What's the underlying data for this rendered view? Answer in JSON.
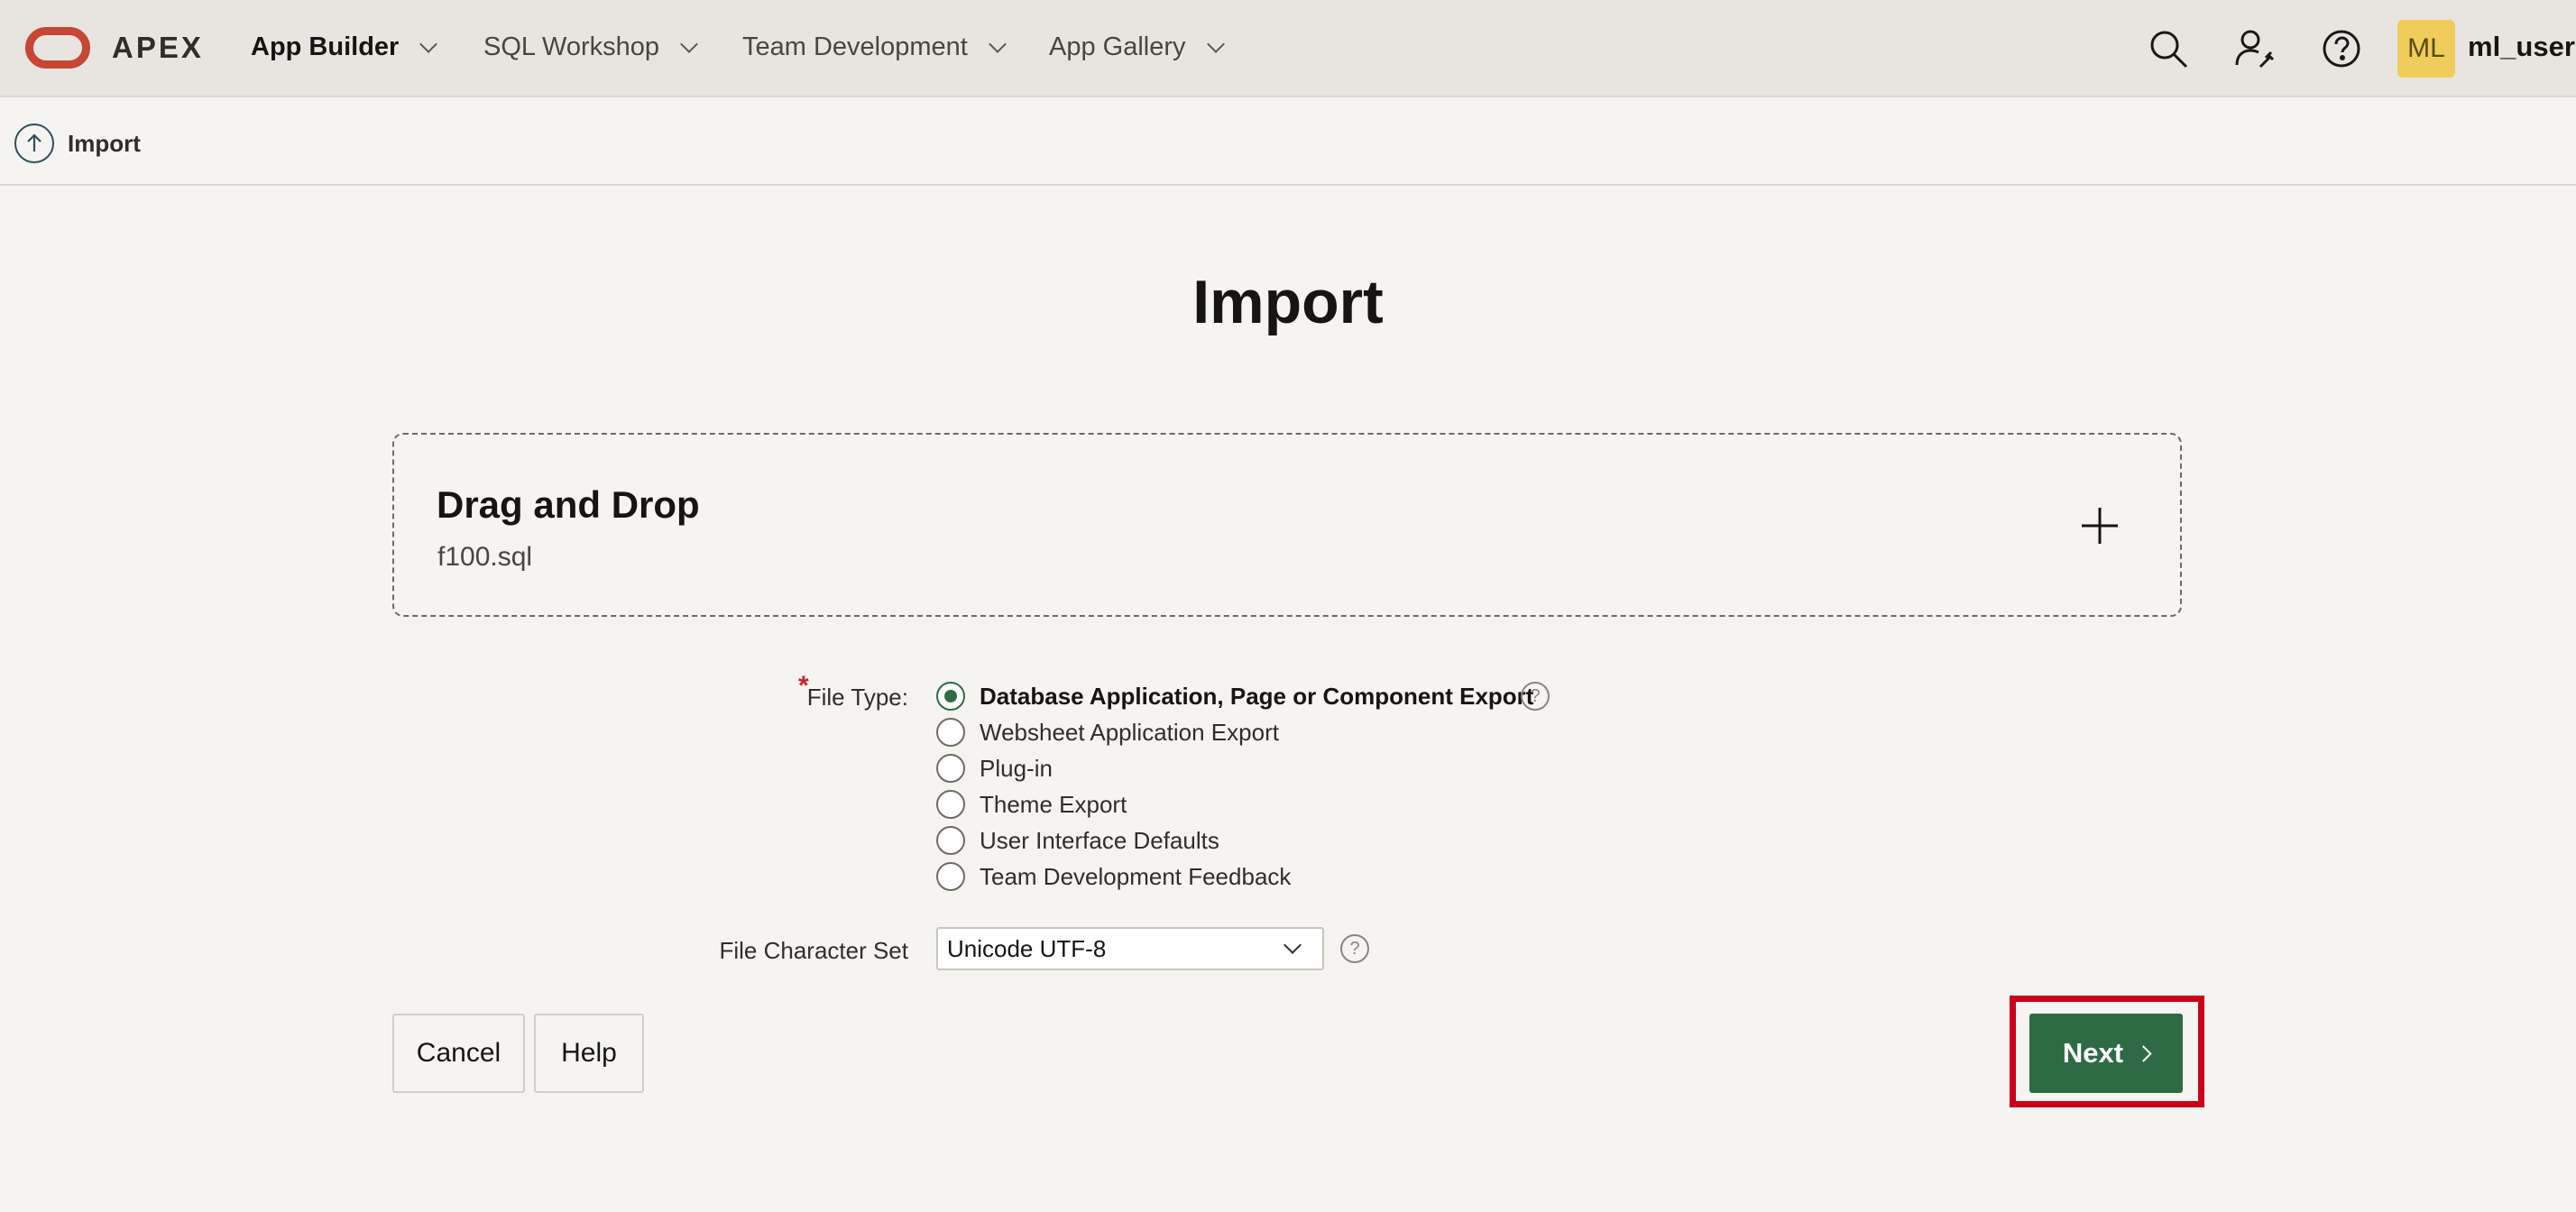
{
  "header": {
    "app_name": "APEX",
    "nav": [
      {
        "label": "App Builder",
        "active": true
      },
      {
        "label": "SQL Workshop",
        "active": false
      },
      {
        "label": "Team Development",
        "active": false
      },
      {
        "label": "App Gallery",
        "active": false
      }
    ],
    "icons": [
      "search-icon",
      "admin-user-icon",
      "help-icon"
    ],
    "user": {
      "initials": "ML",
      "name": "ml_user"
    }
  },
  "breadcrumb": {
    "icon": "upload-arrow-icon",
    "label": "Import"
  },
  "main": {
    "title": "Import",
    "dropzone": {
      "title": "Drag and Drop",
      "file_name": "f100.sql",
      "icon": "plus-icon"
    },
    "file_type": {
      "label": "File Type:",
      "required_mark": "*",
      "options": [
        {
          "label": "Database Application, Page or Component Export",
          "checked": true
        },
        {
          "label": "Websheet Application Export",
          "checked": false
        },
        {
          "label": "Plug-in",
          "checked": false
        },
        {
          "label": "Theme Export",
          "checked": false
        },
        {
          "label": "User Interface Defaults",
          "checked": false
        },
        {
          "label": "Team Development Feedback",
          "checked": false
        }
      ],
      "help_glyph": "?"
    },
    "charset": {
      "label": "File Character Set",
      "value": "Unicode UTF-8",
      "help_glyph": "?"
    },
    "buttons": {
      "cancel": "Cancel",
      "help": "Help",
      "next": "Next"
    }
  },
  "colors": {
    "brand_red": "#c74634",
    "primary_green": "#2e6b45",
    "highlight_red": "#cc0019",
    "avatar_yellow": "#f0cc5a"
  }
}
